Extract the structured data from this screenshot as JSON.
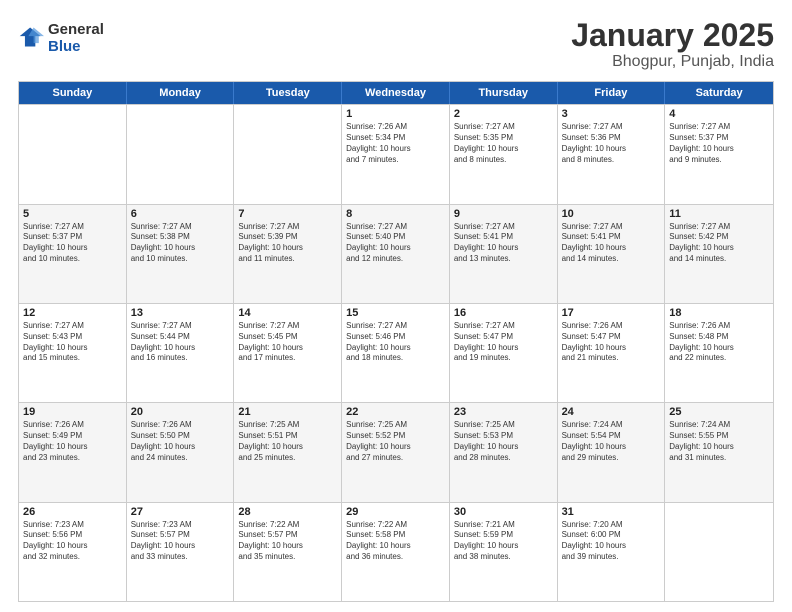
{
  "header": {
    "logo": {
      "general": "General",
      "blue": "Blue"
    },
    "title": "January 2025",
    "subtitle": "Bhogpur, Punjab, India"
  },
  "calendar": {
    "weekdays": [
      "Sunday",
      "Monday",
      "Tuesday",
      "Wednesday",
      "Thursday",
      "Friday",
      "Saturday"
    ],
    "weeks": [
      [
        {
          "day": "",
          "lines": []
        },
        {
          "day": "",
          "lines": []
        },
        {
          "day": "",
          "lines": []
        },
        {
          "day": "1",
          "lines": [
            "Sunrise: 7:26 AM",
            "Sunset: 5:34 PM",
            "Daylight: 10 hours",
            "and 7 minutes."
          ]
        },
        {
          "day": "2",
          "lines": [
            "Sunrise: 7:27 AM",
            "Sunset: 5:35 PM",
            "Daylight: 10 hours",
            "and 8 minutes."
          ]
        },
        {
          "day": "3",
          "lines": [
            "Sunrise: 7:27 AM",
            "Sunset: 5:36 PM",
            "Daylight: 10 hours",
            "and 8 minutes."
          ]
        },
        {
          "day": "4",
          "lines": [
            "Sunrise: 7:27 AM",
            "Sunset: 5:37 PM",
            "Daylight: 10 hours",
            "and 9 minutes."
          ]
        }
      ],
      [
        {
          "day": "5",
          "lines": [
            "Sunrise: 7:27 AM",
            "Sunset: 5:37 PM",
            "Daylight: 10 hours",
            "and 10 minutes."
          ]
        },
        {
          "day": "6",
          "lines": [
            "Sunrise: 7:27 AM",
            "Sunset: 5:38 PM",
            "Daylight: 10 hours",
            "and 10 minutes."
          ]
        },
        {
          "day": "7",
          "lines": [
            "Sunrise: 7:27 AM",
            "Sunset: 5:39 PM",
            "Daylight: 10 hours",
            "and 11 minutes."
          ]
        },
        {
          "day": "8",
          "lines": [
            "Sunrise: 7:27 AM",
            "Sunset: 5:40 PM",
            "Daylight: 10 hours",
            "and 12 minutes."
          ]
        },
        {
          "day": "9",
          "lines": [
            "Sunrise: 7:27 AM",
            "Sunset: 5:41 PM",
            "Daylight: 10 hours",
            "and 13 minutes."
          ]
        },
        {
          "day": "10",
          "lines": [
            "Sunrise: 7:27 AM",
            "Sunset: 5:41 PM",
            "Daylight: 10 hours",
            "and 14 minutes."
          ]
        },
        {
          "day": "11",
          "lines": [
            "Sunrise: 7:27 AM",
            "Sunset: 5:42 PM",
            "Daylight: 10 hours",
            "and 14 minutes."
          ]
        }
      ],
      [
        {
          "day": "12",
          "lines": [
            "Sunrise: 7:27 AM",
            "Sunset: 5:43 PM",
            "Daylight: 10 hours",
            "and 15 minutes."
          ]
        },
        {
          "day": "13",
          "lines": [
            "Sunrise: 7:27 AM",
            "Sunset: 5:44 PM",
            "Daylight: 10 hours",
            "and 16 minutes."
          ]
        },
        {
          "day": "14",
          "lines": [
            "Sunrise: 7:27 AM",
            "Sunset: 5:45 PM",
            "Daylight: 10 hours",
            "and 17 minutes."
          ]
        },
        {
          "day": "15",
          "lines": [
            "Sunrise: 7:27 AM",
            "Sunset: 5:46 PM",
            "Daylight: 10 hours",
            "and 18 minutes."
          ]
        },
        {
          "day": "16",
          "lines": [
            "Sunrise: 7:27 AM",
            "Sunset: 5:47 PM",
            "Daylight: 10 hours",
            "and 19 minutes."
          ]
        },
        {
          "day": "17",
          "lines": [
            "Sunrise: 7:26 AM",
            "Sunset: 5:47 PM",
            "Daylight: 10 hours",
            "and 21 minutes."
          ]
        },
        {
          "day": "18",
          "lines": [
            "Sunrise: 7:26 AM",
            "Sunset: 5:48 PM",
            "Daylight: 10 hours",
            "and 22 minutes."
          ]
        }
      ],
      [
        {
          "day": "19",
          "lines": [
            "Sunrise: 7:26 AM",
            "Sunset: 5:49 PM",
            "Daylight: 10 hours",
            "and 23 minutes."
          ]
        },
        {
          "day": "20",
          "lines": [
            "Sunrise: 7:26 AM",
            "Sunset: 5:50 PM",
            "Daylight: 10 hours",
            "and 24 minutes."
          ]
        },
        {
          "day": "21",
          "lines": [
            "Sunrise: 7:25 AM",
            "Sunset: 5:51 PM",
            "Daylight: 10 hours",
            "and 25 minutes."
          ]
        },
        {
          "day": "22",
          "lines": [
            "Sunrise: 7:25 AM",
            "Sunset: 5:52 PM",
            "Daylight: 10 hours",
            "and 27 minutes."
          ]
        },
        {
          "day": "23",
          "lines": [
            "Sunrise: 7:25 AM",
            "Sunset: 5:53 PM",
            "Daylight: 10 hours",
            "and 28 minutes."
          ]
        },
        {
          "day": "24",
          "lines": [
            "Sunrise: 7:24 AM",
            "Sunset: 5:54 PM",
            "Daylight: 10 hours",
            "and 29 minutes."
          ]
        },
        {
          "day": "25",
          "lines": [
            "Sunrise: 7:24 AM",
            "Sunset: 5:55 PM",
            "Daylight: 10 hours",
            "and 31 minutes."
          ]
        }
      ],
      [
        {
          "day": "26",
          "lines": [
            "Sunrise: 7:23 AM",
            "Sunset: 5:56 PM",
            "Daylight: 10 hours",
            "and 32 minutes."
          ]
        },
        {
          "day": "27",
          "lines": [
            "Sunrise: 7:23 AM",
            "Sunset: 5:57 PM",
            "Daylight: 10 hours",
            "and 33 minutes."
          ]
        },
        {
          "day": "28",
          "lines": [
            "Sunrise: 7:22 AM",
            "Sunset: 5:57 PM",
            "Daylight: 10 hours",
            "and 35 minutes."
          ]
        },
        {
          "day": "29",
          "lines": [
            "Sunrise: 7:22 AM",
            "Sunset: 5:58 PM",
            "Daylight: 10 hours",
            "and 36 minutes."
          ]
        },
        {
          "day": "30",
          "lines": [
            "Sunrise: 7:21 AM",
            "Sunset: 5:59 PM",
            "Daylight: 10 hours",
            "and 38 minutes."
          ]
        },
        {
          "day": "31",
          "lines": [
            "Sunrise: 7:20 AM",
            "Sunset: 6:00 PM",
            "Daylight: 10 hours",
            "and 39 minutes."
          ]
        },
        {
          "day": "",
          "lines": []
        }
      ]
    ]
  }
}
